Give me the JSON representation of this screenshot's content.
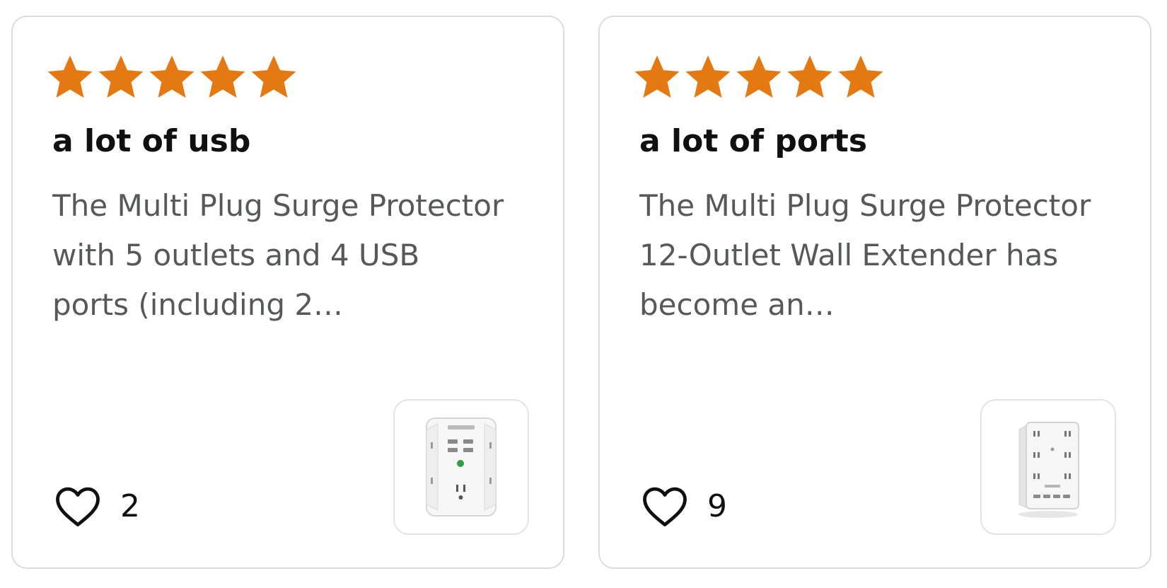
{
  "colors": {
    "star": "#e47911",
    "title_text": "#0f1111",
    "body_text": "#565959",
    "card_border": "#dcdcdc"
  },
  "reviews": [
    {
      "rating_stars": 5,
      "star_icon": "star-icon",
      "title": "a lot of usb",
      "body": "The Multi Plug Surge Protector with 5 outlets and 4 USB ports (including 2…",
      "like_icon": "heart-outline-icon",
      "like_count": "2",
      "product_image": "wall-outlet-extender-usb-image"
    },
    {
      "rating_stars": 5,
      "star_icon": "star-icon",
      "title": "a lot of ports",
      "body": "The Multi Plug Surge Protector 12-Outlet Wall Extender has become an…",
      "like_icon": "heart-outline-icon",
      "like_count": "9",
      "product_image": "wall-outlet-extender-12-image"
    }
  ]
}
